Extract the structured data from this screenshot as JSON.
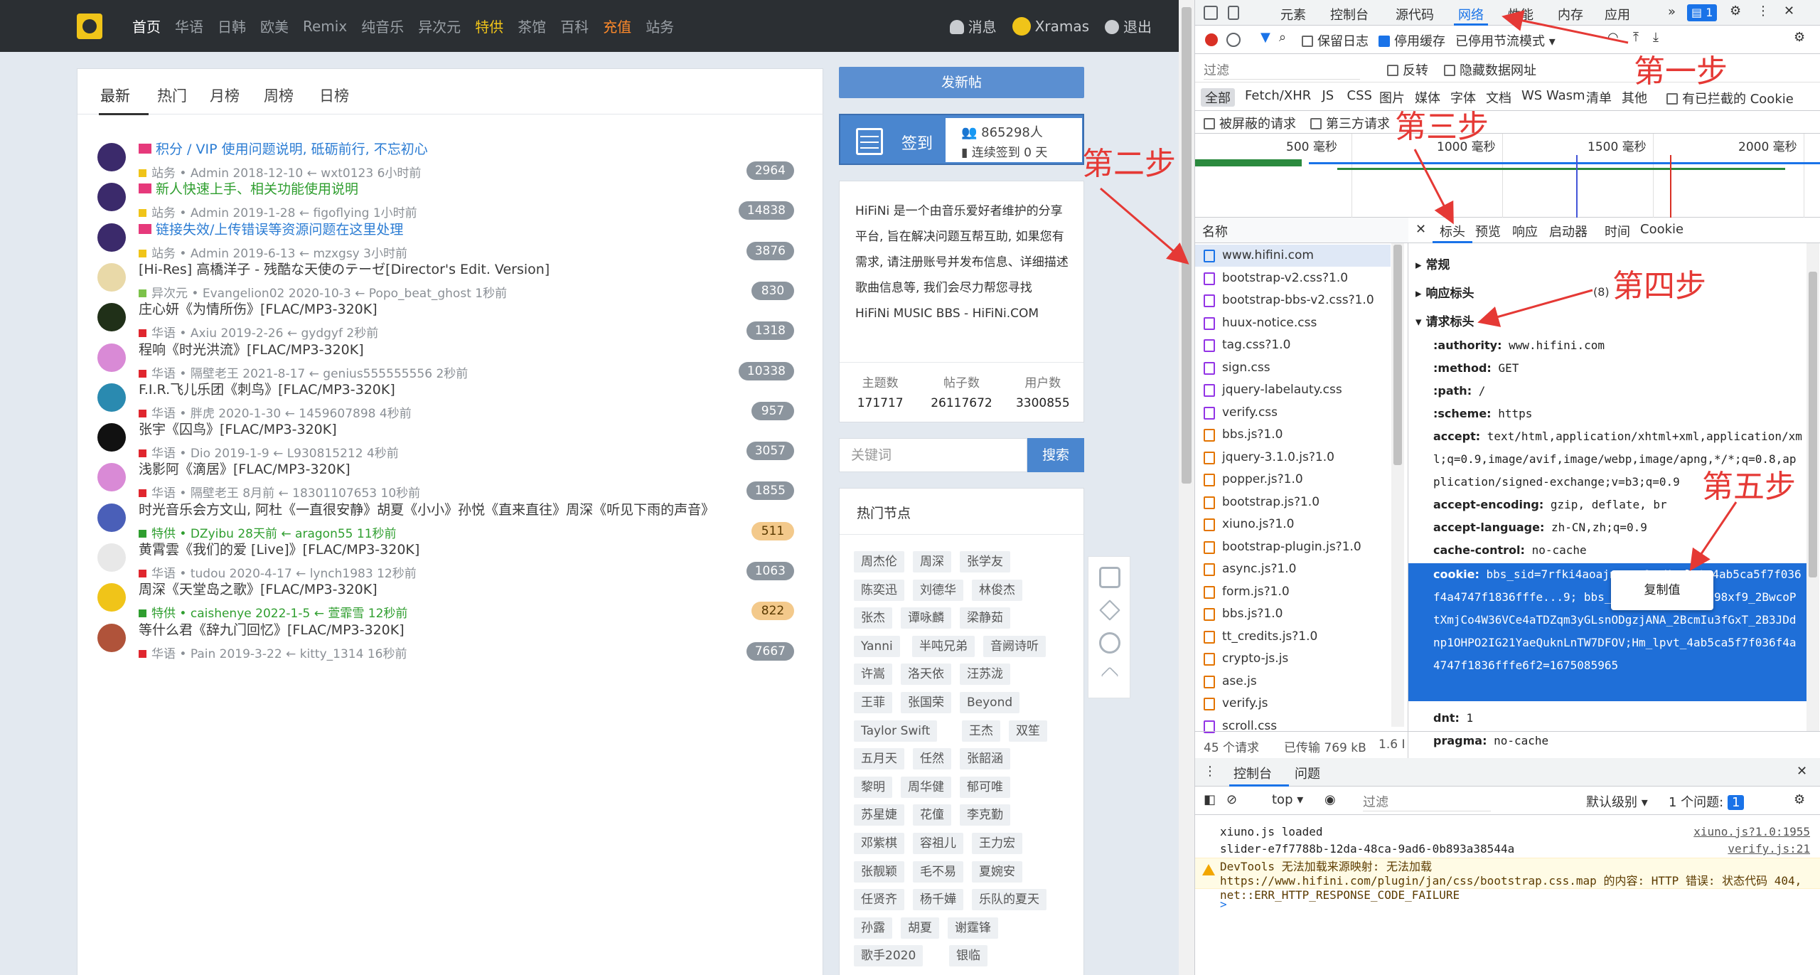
{
  "site": {
    "nav": {
      "items": [
        "首页",
        "华语",
        "日韩",
        "欧美",
        "Remix",
        "纯音乐",
        "异次元",
        "特供",
        "茶馆",
        "百科",
        "充值",
        "站务"
      ],
      "messages": "消息",
      "user": "Xramas",
      "logout": "退出"
    },
    "tabs": [
      "最新",
      "热门",
      "月榜",
      "周榜",
      "日榜"
    ],
    "threads": [
      {
        "title": "积分 / VIP 使用问题说明, 砥砺前行, 不忘初心",
        "style": "blue",
        "flag": true,
        "cat": "站务",
        "cat_color": "#f0c419",
        "author": "Admin",
        "date": "2018-12-10",
        "last": "wxt0123",
        "ago": "6小时前",
        "count": "2964",
        "avatar": "#3b2a6b"
      },
      {
        "title": "新人快速上手、相关功能使用说明",
        "style": "green",
        "flag": true,
        "cat": "站务",
        "cat_color": "#f0c419",
        "author": "Admin",
        "date": "2019-1-28",
        "last": "figoflying",
        "ago": "1小时前",
        "count": "14838",
        "avatar": "#3b2a6b"
      },
      {
        "title": "链接失效/上传错误等资源问题在这里处理",
        "style": "blue",
        "flag": true,
        "cat": "站务",
        "cat_color": "#f0c419",
        "author": "Admin",
        "date": "2019-6-13",
        "last": "mzxgsy",
        "ago": "3小时前",
        "count": "3876",
        "avatar": "#3b2a6b"
      },
      {
        "title": "[Hi-Res] 高橋洋子 - 残酷な天使のテーゼ[Director's Edit. Version]",
        "style": "",
        "flag": false,
        "cat": "异次元",
        "cat_color": "#7cc24a",
        "author": "Evangelion02",
        "date": "2020-10-3",
        "last": "Popo_beat_ghost",
        "ago": "1秒前",
        "count": "830",
        "avatar": "#e9d9a8"
      },
      {
        "title": "庄心妍《为情所伤》[FLAC/MP3-320K]",
        "style": "",
        "flag": false,
        "cat": "华语",
        "cat_color": "#e0262e",
        "author": "Axiu",
        "date": "2019-2-26",
        "last": "gydgyf",
        "ago": "2秒前",
        "count": "1318",
        "avatar": "#203018"
      },
      {
        "title": "程响《时光洪流》[FLAC/MP3-320K]",
        "style": "",
        "flag": false,
        "cat": "华语",
        "cat_color": "#e0262e",
        "author": "隔壁老王",
        "date": "2021-8-17",
        "last": "genius555555556",
        "ago": "2秒前",
        "count": "10338",
        "avatar": "#d98ad6"
      },
      {
        "title": "F.I.R.飞儿乐团《刺鸟》[FLAC/MP3-320K]",
        "style": "",
        "flag": false,
        "cat": "华语",
        "cat_color": "#e0262e",
        "author": "胖虎",
        "date": "2020-1-30",
        "last": "1459607898",
        "ago": "4秒前",
        "count": "957",
        "avatar": "#2a8ab0"
      },
      {
        "title": "张宇《囚鸟》[FLAC/MP3-320K]",
        "style": "",
        "flag": false,
        "cat": "华语",
        "cat_color": "#e0262e",
        "author": "Dio",
        "date": "2019-1-9",
        "last": "L930815212",
        "ago": "4秒前",
        "count": "3057",
        "avatar": "#111111"
      },
      {
        "title": "浅影阿《滴居》[FLAC/MP3-320K]",
        "style": "",
        "flag": false,
        "cat": "华语",
        "cat_color": "#e0262e",
        "author": "隔壁老王",
        "date": "8月前",
        "last": "18301107653",
        "ago": "10秒前",
        "count": "1855",
        "avatar": "#d98ad6"
      },
      {
        "title": "时光音乐会方文山, 阿杜《一直很安静》胡夏《小小》孙悦《直来直往》周深《听见下雨的声音》",
        "style": "",
        "flag": false,
        "cat": "特供",
        "cat_color": "#2f9e2f",
        "author": "DZyibu",
        "date": "28天前",
        "last": "aragon55",
        "ago": "11秒前",
        "count": "511",
        "avatar": "#4a5fb8",
        "meta_green": true,
        "gold": true
      },
      {
        "title": "黄霄雲《我们的爱 [Live]》[FLAC/MP3-320K]",
        "style": "",
        "flag": false,
        "cat": "华语",
        "cat_color": "#e0262e",
        "author": "tudou",
        "date": "2020-4-17",
        "last": "lynch1983",
        "ago": "12秒前",
        "count": "1063",
        "avatar": "#e8e8e8"
      },
      {
        "title": "周深《天堂岛之歌》[FLAC/MP3-320K]",
        "style": "",
        "flag": false,
        "cat": "特供",
        "cat_color": "#2f9e2f",
        "author": "caishenye",
        "date": "2022-1-5",
        "last": "萱霏雪",
        "ago": "12秒前",
        "count": "822",
        "avatar": "#f0c419",
        "meta_green": true,
        "gold": true
      },
      {
        "title": "等什么君《辞九门回忆》[FLAC/MP3-320K]",
        "style": "",
        "flag": false,
        "cat": "华语",
        "cat_color": "#e0262e",
        "author": "Pain",
        "date": "2019-3-22",
        "last": "kitty_1314",
        "ago": "16秒前",
        "count": "7667",
        "avatar": "#b0533a"
      }
    ],
    "post_button": "发新帖",
    "signin": {
      "label": "签到",
      "users": "865298人",
      "streak": "连续签到 0 天"
    },
    "about": {
      "text": "HiFiNi 是一个由音乐爱好者维护的分享平台, 旨在解决问题互帮互助, 如果您有需求, 请注册账号并发布信息、详细描述歌曲信息等, 我们会尽力帮您寻找",
      "tagline": "HiFiNi MUSIC BBS - HiFiNi.COM",
      "stats": [
        {
          "k": "主题数",
          "v": "171717"
        },
        {
          "k": "帖子数",
          "v": "26117672"
        },
        {
          "k": "用户数",
          "v": "3300855"
        }
      ]
    },
    "search": {
      "placeholder": "关键词",
      "button": "搜索"
    },
    "hot": {
      "title": "热门节点",
      "rows": [
        [
          "周杰伦",
          "周深",
          "张学友"
        ],
        [
          "陈奕迅",
          "刘德华",
          "林俊杰"
        ],
        [
          "张杰",
          "谭咏麟",
          "梁静茹"
        ],
        [
          "Yanni",
          "半吨兄弟",
          "音阙诗听"
        ],
        [
          "许嵩",
          "洛天依",
          "汪苏泷"
        ],
        [
          "王菲",
          "张国荣",
          "Beyond"
        ],
        [
          "Taylor Swift",
          "王杰",
          "双笙"
        ],
        [
          "五月天",
          "任然",
          "张韶涵"
        ],
        [
          "黎明",
          "周华健",
          "郁可唯"
        ],
        [
          "苏星婕",
          "花僮",
          "李克勤"
        ],
        [
          "邓紫棋",
          "容祖儿",
          "王力宏"
        ],
        [
          "张靓颖",
          "毛不易",
          "夏婉安"
        ],
        [
          "任贤齐",
          "杨千嬅",
          "乐队的夏天"
        ],
        [
          "孙露",
          "胡夏",
          "谢霆锋"
        ],
        [
          "歌手2020",
          "银临"
        ]
      ]
    }
  },
  "devtools": {
    "tabs": [
      "元素",
      "控制台",
      "源代码",
      "网络",
      "性能",
      "内存",
      "应用"
    ],
    "active_tab": "网络",
    "badge": "1",
    "toolbar": {
      "preserve_log": "保留日志",
      "disable_cache": "停用缓存",
      "throttle": "已停用节流模式"
    },
    "filter": {
      "placeholder": "过滤",
      "invert": "反转",
      "hide_data": "隐藏数据网址"
    },
    "types": [
      "全部",
      "Fetch/XHR",
      "JS",
      "CSS",
      "图片",
      "媒体",
      "字体",
      "文档",
      "WS",
      "Wasm",
      "清单",
      "其他"
    ],
    "blocked_cookies": "有已拦截的 Cookie",
    "blocked_requests": "被屏蔽的请求",
    "third_party": "第三方请求",
    "timeline_ticks": [
      "500 毫秒",
      "1000 毫秒",
      "1500 毫秒",
      "2000 毫秒"
    ],
    "name_header": "名称",
    "requests": [
      {
        "name": "www.hifini.com",
        "type": "doc"
      },
      {
        "name": "bootstrap-v2.css?1.0",
        "type": "css"
      },
      {
        "name": "bootstrap-bbs-v2.css?1.0",
        "type": "css"
      },
      {
        "name": "huux-notice.css",
        "type": "css"
      },
      {
        "name": "tag.css?1.0",
        "type": "css"
      },
      {
        "name": "sign.css",
        "type": "css"
      },
      {
        "name": "jquery-labelauty.css",
        "type": "css"
      },
      {
        "name": "verify.css",
        "type": "css"
      },
      {
        "name": "bbs.js?1.0",
        "type": "js"
      },
      {
        "name": "jquery-3.1.0.js?1.0",
        "type": "js"
      },
      {
        "name": "popper.js?1.0",
        "type": "js"
      },
      {
        "name": "bootstrap.js?1.0",
        "type": "js"
      },
      {
        "name": "xiuno.js?1.0",
        "type": "js"
      },
      {
        "name": "bootstrap-plugin.js?1.0",
        "type": "js"
      },
      {
        "name": "async.js?1.0",
        "type": "js"
      },
      {
        "name": "form.js?1.0",
        "type": "js"
      },
      {
        "name": "bbs.js?1.0",
        "type": "js"
      },
      {
        "name": "tt_credits.js?1.0",
        "type": "js"
      },
      {
        "name": "crypto-js.js",
        "type": "js"
      },
      {
        "name": "ase.js",
        "type": "js"
      },
      {
        "name": "verify.js",
        "type": "js"
      },
      {
        "name": "scroll.css",
        "type": "css"
      }
    ],
    "footer": {
      "requests": "45 个请求",
      "transferred": "已传输 769 kB",
      "more": "1.6 I"
    },
    "detail_tabs": [
      "标头",
      "预览",
      "响应",
      "启动器",
      "时间",
      "Cookie"
    ],
    "sections": {
      "general": "常规",
      "response": "响应标头",
      "response_count": "(8)",
      "request": "请求标头"
    },
    "headers": [
      {
        "k": ":authority:",
        "v": "www.hifini.com"
      },
      {
        "k": ":method:",
        "v": "GET"
      },
      {
        "k": ":path:",
        "v": "/"
      },
      {
        "k": ":scheme:",
        "v": "https"
      },
      {
        "k": "accept:",
        "v": "text/html,application/xhtml+xml,application/xml;q=0.9,image/avif,image/webp,image/apng,*/*;q=0.8,application/signed-exchange;v=b3;q=0.9"
      },
      {
        "k": "accept-encoding:",
        "v": "gzip, deflate, br"
      },
      {
        "k": "accept-language:",
        "v": "zh-CN,zh;q=0.9"
      },
      {
        "k": "cache-control:",
        "v": "no-cache"
      }
    ],
    "cookie": {
      "k": "cookie:",
      "v": "bbs_sid=7rfki4aoajnr...9; Hm_lvt_4ab5ca5f7f036f4a4747f1836fffe...9; bbs_token=R74mq3S2u98xf9_2BwcoPtXmjCo4W36VCe4aTDZqm3yGLsnODgzjANA_2BcmIu3fGxT_2B3JDdnp1OHPO2IG21YaeQuknLnTW7DFOV;Hm_lpvt_4ab5ca5f7f036f4a4747f1836fffe6f2=1675085965"
    },
    "copy_menu": "复制值",
    "after_headers": [
      {
        "k": "dnt:",
        "v": "1"
      },
      {
        "k": "pragma:",
        "v": "no-cache"
      }
    ],
    "console": {
      "tabs": [
        "控制台",
        "问题"
      ],
      "context": "top",
      "filter": "过滤",
      "level": "默认级别",
      "issues": "1 个问题:",
      "issues_badge": "1",
      "lines": [
        {
          "text": "xiuno.js loaded",
          "src": "xiuno.js?1.0:1955"
        },
        {
          "text": "slider-e7f7788b-12da-48ca-9ad6-0b893a38544a",
          "src": "verify.js:21"
        }
      ],
      "warning": "DevTools 无法加载来源映射: 无法加载 https://www.hifini.com/plugin/jan/css/bootstrap.css.map 的内容: HTTP 错误: 状态代码 404, net::ERR_HTTP_RESPONSE_CODE_FAILURE",
      "prompt": ">"
    }
  },
  "annotations": {
    "step1": "第一步",
    "step2": "第二步",
    "step3": "第三步",
    "step4": "第四步",
    "step5": "第五步"
  },
  "colors": {
    "annotation": "#e53935",
    "accent": "#1a73e8",
    "site_blue": "#4a86cf"
  }
}
